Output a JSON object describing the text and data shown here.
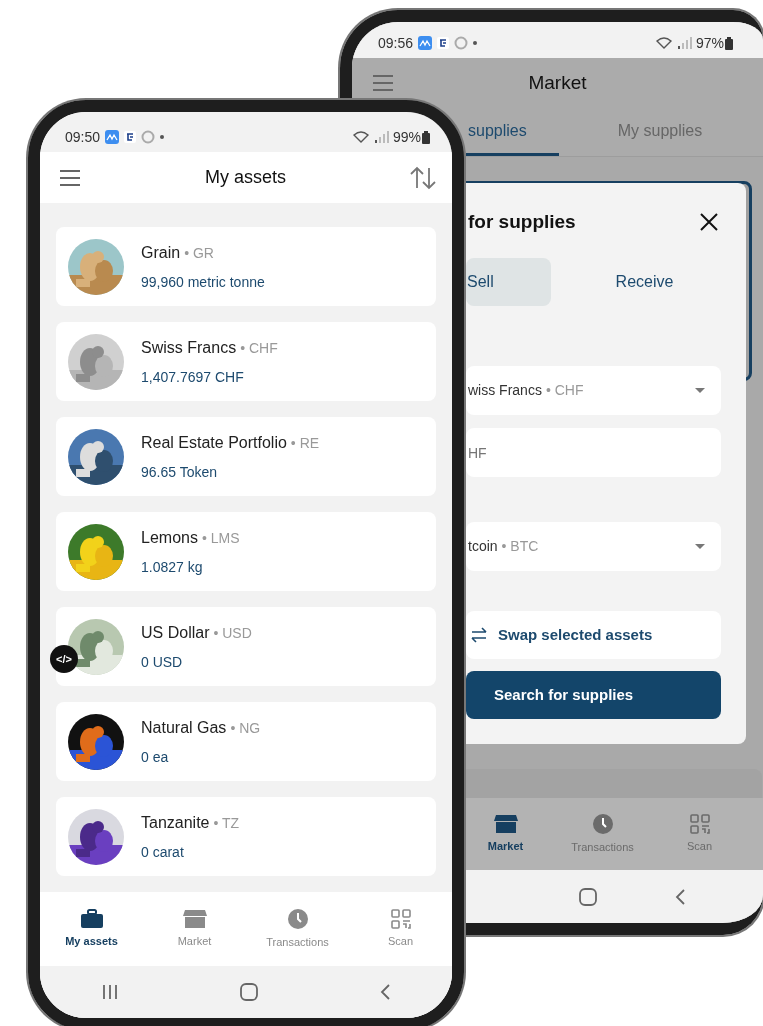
{
  "back_phone": {
    "status_bar": {
      "time": "09:56",
      "battery": "97%"
    },
    "header": {
      "title": "Market"
    },
    "tabs": [
      {
        "label": "supplies",
        "selected": true
      },
      {
        "label": "My supplies",
        "selected": false
      }
    ],
    "dialog": {
      "title": "for supplies",
      "modes": [
        {
          "label": "Sell",
          "selected": true
        },
        {
          "label": "Receive",
          "selected": false
        }
      ],
      "sell_asset": {
        "name": "wiss Francs",
        "code": "• CHF"
      },
      "amount": {
        "placeholder": "HF"
      },
      "receive_asset": {
        "name": "tcoin",
        "code": "• BTC"
      },
      "swap_button": "Swap selected assets",
      "search_button": "Search for supplies"
    },
    "bottom_nav": [
      {
        "kind": "market",
        "label": "Market",
        "selected": true
      },
      {
        "kind": "transactions",
        "label": "Transactions",
        "selected": false
      },
      {
        "kind": "scan",
        "label": "Scan",
        "selected": false
      }
    ]
  },
  "front_phone": {
    "status_bar": {
      "time": "09:50",
      "battery": "99%"
    },
    "header": {
      "title": "My assets"
    },
    "assets": [
      {
        "name": "Grain",
        "code": "• GR",
        "amount": "99,960 metric tonne"
      },
      {
        "name": "Swiss Francs",
        "code": "• CHF",
        "amount": "1,407.7697 CHF"
      },
      {
        "name": "Real Estate Portfolio",
        "code": "• RE",
        "amount": "96.65 Token"
      },
      {
        "name": "Lemons",
        "code": "• LMS",
        "amount": "1.0827 kg"
      },
      {
        "name": "US Dollar",
        "code": "• USD",
        "amount": "0 USD"
      },
      {
        "name": "Natural Gas",
        "code": "• NG",
        "amount": "0 ea"
      },
      {
        "name": "Tanzanite",
        "code": "• TZ",
        "amount": "0 carat"
      }
    ],
    "dev_badge": "</>",
    "bottom_nav": [
      {
        "kind": "assets",
        "label": "My assets",
        "selected": true
      },
      {
        "kind": "market",
        "label": "Market",
        "selected": false
      },
      {
        "kind": "transactions",
        "label": "Transactions",
        "selected": false
      },
      {
        "kind": "scan",
        "label": "Scan",
        "selected": false
      }
    ]
  }
}
